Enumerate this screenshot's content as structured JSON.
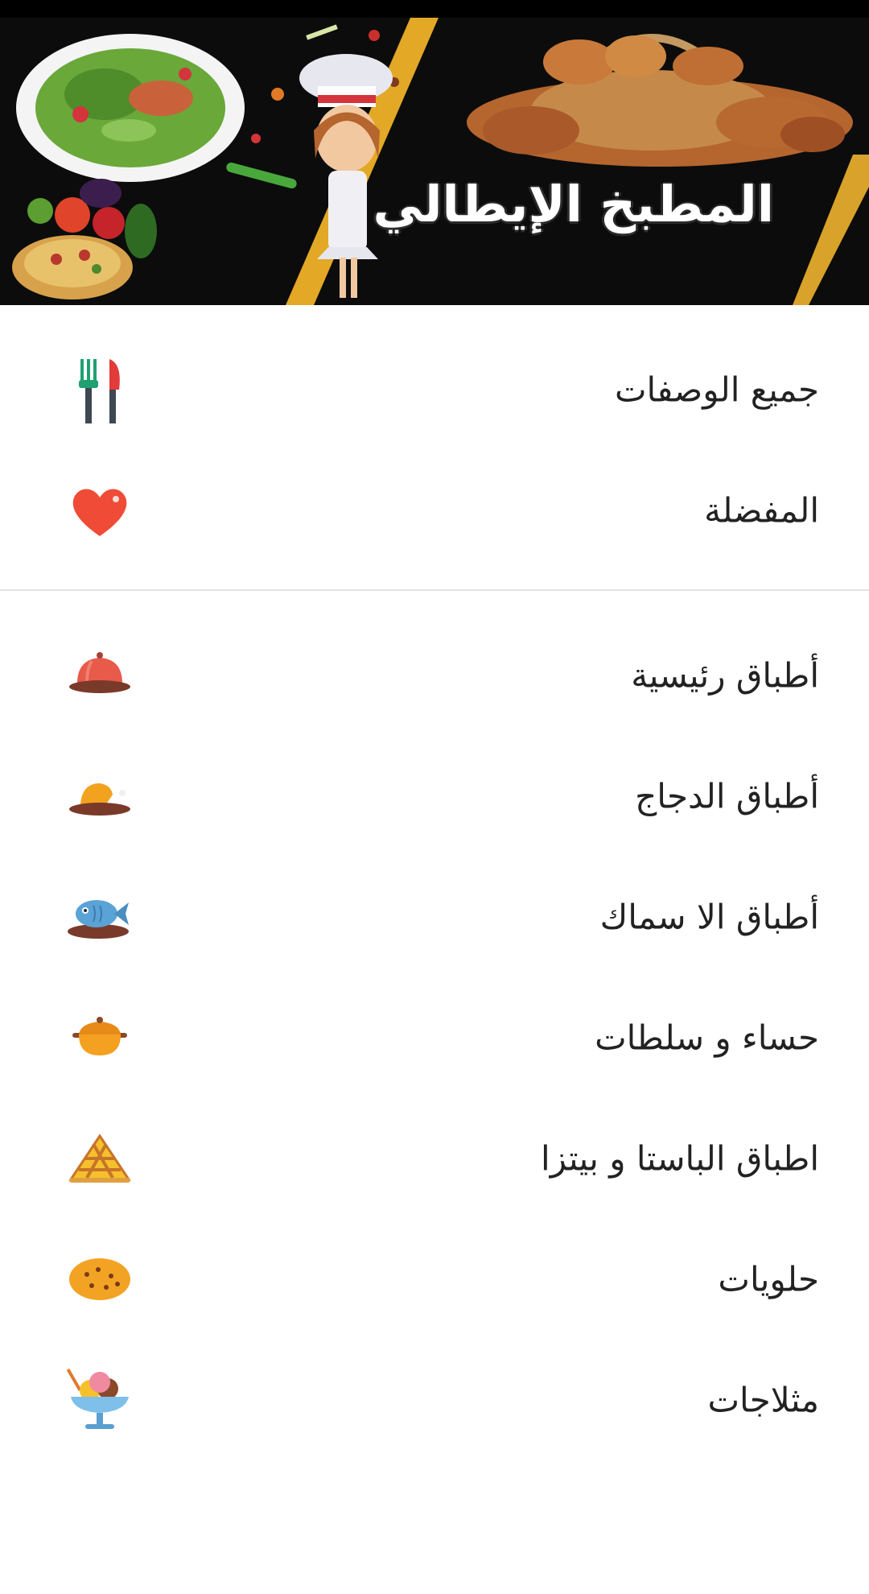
{
  "app": {
    "header_title": "المطبخ الإيطالي"
  },
  "menu": {
    "primary": [
      {
        "label": "جميع الوصفات",
        "icon": "utensils-icon"
      },
      {
        "label": "المفضلة",
        "icon": "heart-icon"
      }
    ],
    "categories": [
      {
        "label": "أطباق رئيسية",
        "icon": "cloche-icon"
      },
      {
        "label": "أطباق الدجاج",
        "icon": "chicken-icon"
      },
      {
        "label": "أطباق الا سماك",
        "icon": "fish-icon"
      },
      {
        "label": "حساء و سلطات",
        "icon": "soup-pot-icon"
      },
      {
        "label": "اطباق الباستا و بيتزا",
        "icon": "pizza-slice-icon"
      },
      {
        "label": "حلويات",
        "icon": "cookie-icon"
      },
      {
        "label": "مثلاجات",
        "icon": "ice-cream-icon"
      }
    ]
  },
  "colors": {
    "header_bg": "#0c0c0c",
    "accent_gold": "#e2a826",
    "text": "#222222",
    "divider": "#e3e3e3"
  }
}
